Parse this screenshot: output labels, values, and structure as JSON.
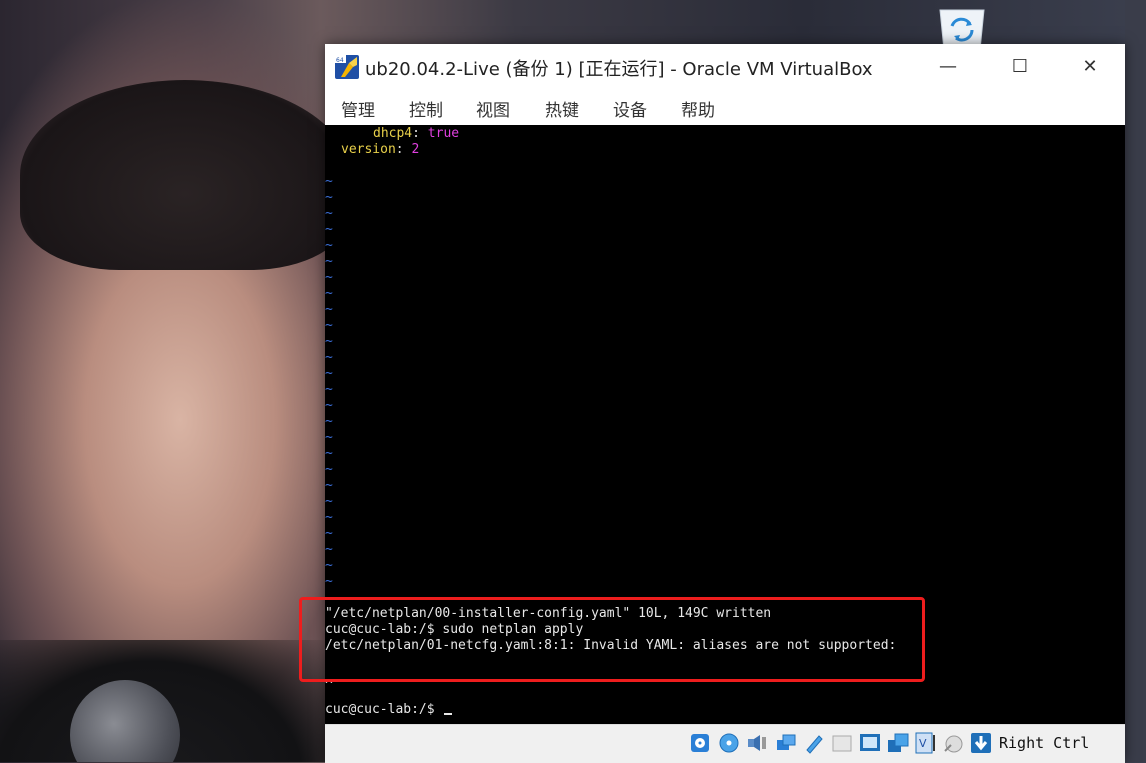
{
  "window": {
    "title": "ub20.04.2-Live (备份 1) [正在运行] - Oracle VM VirtualBox"
  },
  "window_controls": {
    "minimize": "—",
    "maximize": "☐",
    "close": "✕"
  },
  "menu": [
    "管理",
    "控制",
    "视图",
    "热键",
    "设备",
    "帮助"
  ],
  "console": {
    "yaml": [
      {
        "key": "dhcp4",
        "value": "true"
      },
      {
        "key": "version",
        "value": "2"
      }
    ],
    "tilde": "~",
    "output": [
      "\"/etc/netplan/00-installer-config.yaml\" 10L, 149C written",
      "cuc@cuc-lab:/$ sudo netplan apply",
      "/etc/netplan/01-netcfg.yaml:8:1: Invalid YAML: aliases are not supported:",
      "",
      "^",
      "cuc@cuc-lab:/$ "
    ]
  },
  "statusbar": {
    "host_key": "Right Ctrl",
    "icons": [
      "hard-disk-icon",
      "optical-drive-icon",
      "audio-icon",
      "network-icon",
      "usb-icon",
      "shared-folders-icon",
      "display-icon",
      "video-capture-icon",
      "virtualization-icon",
      "mouse-integration-icon",
      "keyboard-capture-icon"
    ]
  },
  "colors": {
    "highlight_box": "#ee1d1d",
    "yaml_key": "#e8d04a",
    "yaml_value": "#e040e0",
    "tilde": "#3b6fd8"
  }
}
